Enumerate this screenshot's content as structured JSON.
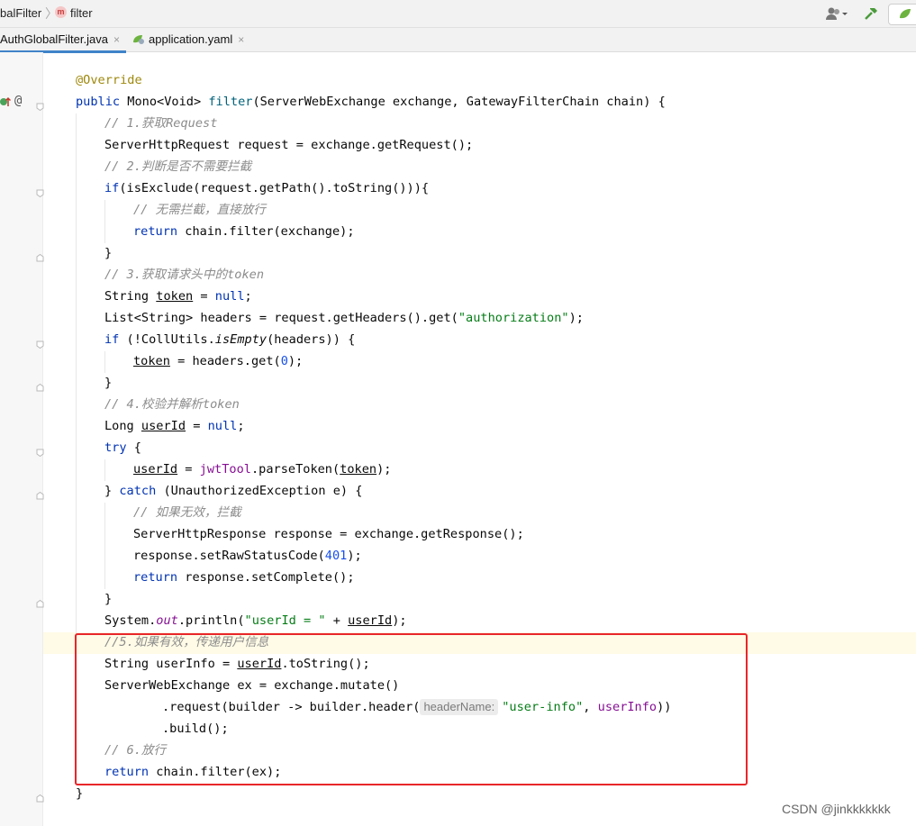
{
  "breadcrumb": {
    "class_name": "balFilter",
    "method_badge": "m",
    "method_name": "filter"
  },
  "tabs": [
    {
      "label": "AuthGlobalFilter.java",
      "close": "×"
    },
    {
      "label": "application.yaml",
      "close": "×"
    }
  ],
  "gutter": {
    "annotation_marker": "@"
  },
  "code": {
    "l1": [
      "@Override"
    ],
    "l2": [
      "public",
      " Mono<Void> ",
      "filter",
      "(ServerWebExchange exchange, GatewayFilterChain chain) {"
    ],
    "l3": [
      "// 1.获取Request"
    ],
    "l4": [
      "ServerHttpRequest request = exchange.getRequest();"
    ],
    "l5": [
      "// 2.判断是否不需要拦截"
    ],
    "l6": [
      "if",
      "(isExclude(request.getPath().toString())){"
    ],
    "l7": [
      "// 无需拦截，直接放行"
    ],
    "l8": [
      "return",
      " chain.filter(exchange);"
    ],
    "l9": [
      "}"
    ],
    "l10": [
      "// 3.获取请求头中的token"
    ],
    "l11": [
      "String ",
      "token",
      " = ",
      "null",
      ";"
    ],
    "l12": [
      "List<String> headers = request.getHeaders().get(",
      "\"authorization\"",
      ");"
    ],
    "l13": [
      "if",
      " (!CollUtils.",
      "isEmpty",
      "(headers)) {"
    ],
    "l14": [
      "token",
      " = headers.get(",
      "0",
      ");"
    ],
    "l15": [
      "}"
    ],
    "l16": [
      "// 4.校验并解析token"
    ],
    "l17": [
      "Long ",
      "userId",
      " = ",
      "null",
      ";"
    ],
    "l18": [
      "try",
      " {"
    ],
    "l19": [
      "userId",
      " = ",
      "jwtTool",
      ".parseToken(",
      "token",
      ");"
    ],
    "l20": [
      "} ",
      "catch",
      " (UnauthorizedException e) {"
    ],
    "l21": [
      "// 如果无效，拦截"
    ],
    "l22": [
      "ServerHttpResponse response = exchange.getResponse();"
    ],
    "l23": [
      "response.setRawStatusCode(",
      "401",
      ");"
    ],
    "l24": [
      "return",
      " response.setComplete();"
    ],
    "l25": [
      "}"
    ],
    "l26": [
      "System.",
      "out",
      ".println(",
      "\"userId = \"",
      " + ",
      "userId",
      ");"
    ],
    "l27": [
      "//5.如果有效，传递用户信息"
    ],
    "l28": [
      "String userInfo = ",
      "userId",
      ".toString();"
    ],
    "l29": [
      "ServerWebExchange ex = exchange.mutate()"
    ],
    "l30": [
      ".request(builder -> builder.header(",
      "headerName:",
      "\"user-info\"",
      ", ",
      "userInfo",
      "))"
    ],
    "l31": [
      ".build();"
    ],
    "l32": [
      "// 6.放行"
    ],
    "l33": [
      "return",
      " chain.filter(ex);"
    ],
    "l34": [
      "}"
    ]
  },
  "watermark": "CSDN @jinkkkkkkk",
  "colors": {
    "keyword": "#0033b3",
    "string": "#067d17",
    "comment": "#8c8c8c",
    "annotation": "#9e880d",
    "number": "#1750eb",
    "highlight_box": "#e8262a"
  }
}
